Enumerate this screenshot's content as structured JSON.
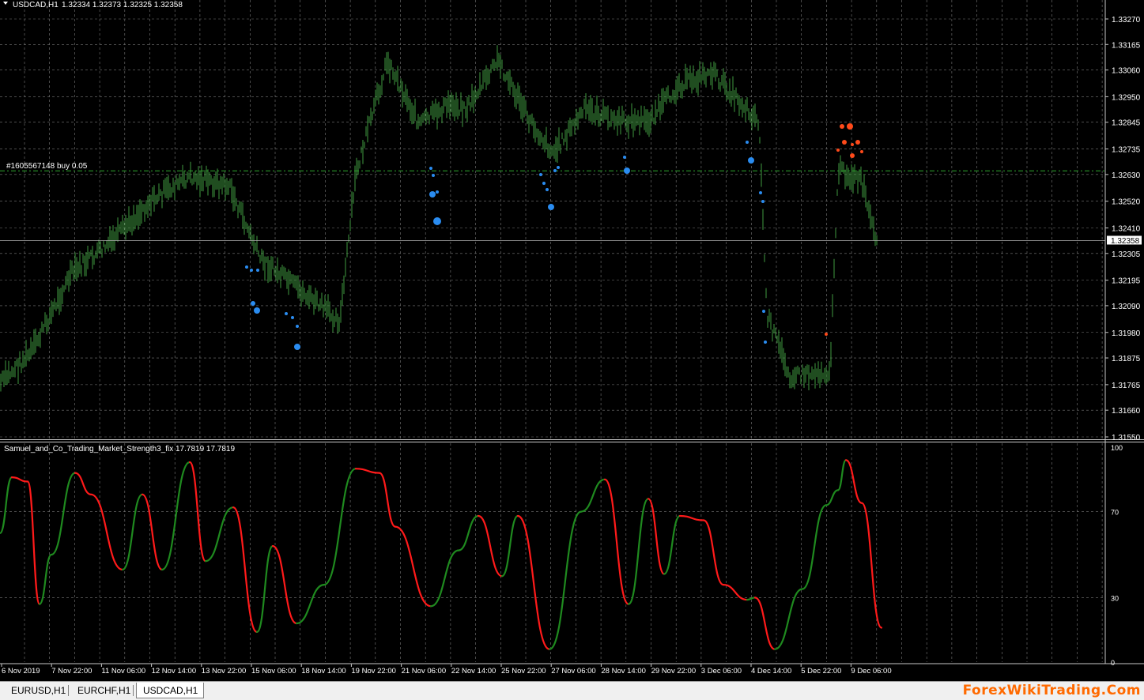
{
  "header": {
    "symbol": "USDCAD,H1",
    "ohlc": "1.32334 1.32373 1.32325 1.32358"
  },
  "order_line": {
    "label": "#1605567148 buy 0.05",
    "price": 1.32645
  },
  "price_axis": {
    "ticks": [
      "1.33270",
      "1.33165",
      "1.33060",
      "1.32950",
      "1.32845",
      "1.32735",
      "1.32630",
      "1.32520",
      "1.32410",
      "1.32305",
      "1.32195",
      "1.32090",
      "1.31980",
      "1.31875",
      "1.31765",
      "1.31660",
      "1.31550"
    ],
    "current_price": "1.32358"
  },
  "indicator": {
    "label": "Samuel_and_Co_Trading_Market_Strength3_fix 17.7819 17.7819",
    "levels": [
      "100",
      "70",
      "30",
      "0"
    ]
  },
  "time_axis": {
    "labels": [
      "6 Nov 2019",
      "7 Nov 22:00",
      "11 Nov 06:00",
      "12 Nov 14:00",
      "13 Nov 22:00",
      "15 Nov 06:00",
      "18 Nov 14:00",
      "19 Nov 22:00",
      "21 Nov 06:00",
      "22 Nov 14:00",
      "25 Nov 22:00",
      "27 Nov 06:00",
      "28 Nov 14:00",
      "29 Nov 22:00",
      "3 Dec 06:00",
      "4 Dec 14:00",
      "5 Dec 22:00",
      "9 Dec 06:00"
    ]
  },
  "tabs": [
    {
      "label": "EURUSD,H1",
      "active": false
    },
    {
      "label": "EURCHF,H1",
      "active": false
    },
    {
      "label": "USDCAD,H1",
      "active": true
    }
  ],
  "watermark": "ForexWikiTrading.Com",
  "colors": {
    "background": "#000000",
    "grid": "#7a7a7a",
    "bars": "#3f9a3f",
    "buy_dots": "#2a8cf0",
    "sell_dots": "#ff4a1a",
    "indicator_up": "#1f8a1f",
    "indicator_down": "#ff1a1a",
    "order_line": "#2fa82f"
  },
  "chart_data": {
    "type": "line",
    "series": [
      {
        "x": [
          0,
          40,
          90,
          140,
          190,
          240,
          290,
          330,
          380,
          430,
          450,
          490,
          530,
          570,
          590,
          630,
          670,
          700,
          740,
          780,
          820,
          860,
          900,
          930,
          960,
          970,
          1000,
          1050,
          1060,
          1090,
          1110
        ],
        "values": [
          1.3177,
          1.319,
          1.3222,
          1.3235,
          1.3252,
          1.3262,
          1.3258,
          1.3228,
          1.3215,
          1.3203,
          1.3263,
          1.331,
          1.3284,
          1.3292,
          1.329,
          1.331,
          1.3285,
          1.3272,
          1.329,
          1.3285,
          1.3285,
          1.33,
          1.3305,
          1.3295,
          1.3285,
          1.3205,
          1.318,
          1.3182,
          1.3265,
          1.326,
          1.3232
        ]
      },
      {
        "x": [
          0,
          15,
          35,
          50,
          65,
          95,
          115,
          155,
          180,
          205,
          240,
          260,
          295,
          325,
          345,
          375,
          410,
          450,
          480,
          500,
          545,
          580,
          605,
          635,
          655,
          695,
          735,
          765,
          795,
          820,
          840,
          860,
          890,
          915,
          945,
          955,
          980,
          1015,
          1045,
          1060,
          1070,
          1090,
          1115
        ],
        "values": [
          60,
          86,
          84,
          27,
          50,
          88,
          78,
          43,
          78,
          43,
          93,
          47,
          72,
          14,
          54,
          18,
          36,
          90,
          88,
          63,
          26,
          52,
          68,
          40,
          68,
          6,
          70,
          85,
          27,
          76,
          41,
          68,
          66,
          36,
          29,
          30,
          6,
          34,
          73,
          80,
          94,
          74,
          16
        ]
      }
    ]
  }
}
